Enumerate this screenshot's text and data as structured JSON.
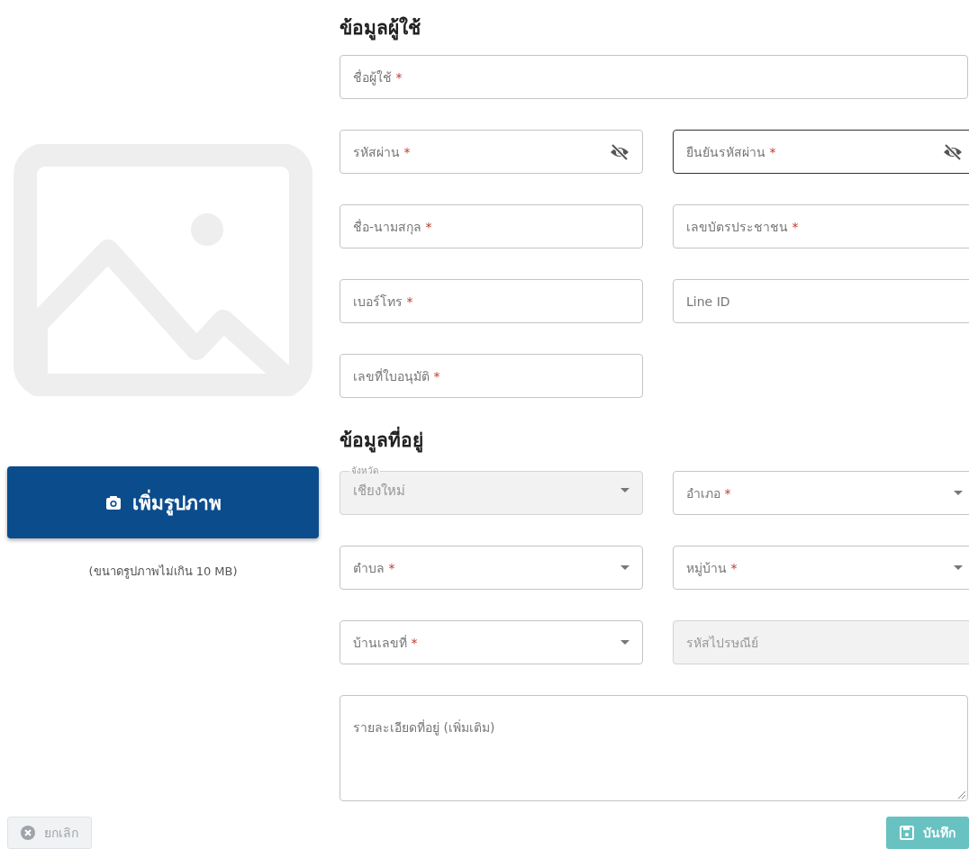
{
  "photo": {
    "kind": "picture",
    "add_button": "เพิ่มรูปภาพ",
    "note": "(ขนาดรูปภาพไม่เกิน 10 MB)"
  },
  "sections": [
    {
      "title": "ข้อมูลผู้ใช้",
      "rows": [
        [
          {
            "kind": "text",
            "placeholder": "ชื่อผู้ใช้",
            "required_mark": "*",
            "full_width": true
          }
        ],
        [
          {
            "kind": "password",
            "placeholder": "รหัสผ่าน",
            "required_mark": "*"
          },
          {
            "kind": "password",
            "placeholder": "ยืนยันรหัสผ่าน",
            "required_mark": "*",
            "focused": true
          }
        ],
        [
          {
            "kind": "text",
            "placeholder": "ชื่อ-นามสกุล",
            "required_mark": "*"
          },
          {
            "kind": "text",
            "placeholder": "เลขบัตรประชาชน",
            "required_mark": "*"
          }
        ],
        [
          {
            "kind": "text",
            "placeholder": "เบอร์โทร",
            "required_mark": "*"
          },
          {
            "kind": "text",
            "placeholder": "Line ID"
          }
        ],
        [
          {
            "kind": "text",
            "placeholder": "เลขที่ใบอนุมัติ",
            "required_mark": "*"
          }
        ]
      ]
    },
    {
      "title": "ข้อมูลที่อยู่",
      "rows": [
        [
          {
            "kind": "select",
            "label": "จังหวัด",
            "value": "เชียงใหม่",
            "disabled": true
          },
          {
            "kind": "select",
            "placeholder": "อำเภอ",
            "required_mark": "*"
          }
        ],
        [
          {
            "kind": "select",
            "placeholder": "ตำบล",
            "required_mark": "*"
          },
          {
            "kind": "select",
            "placeholder": "หมู่บ้าน",
            "required_mark": "*"
          }
        ],
        [
          {
            "kind": "select",
            "placeholder": "บ้านเลขที่",
            "required_mark": "*"
          },
          {
            "kind": "text",
            "placeholder": "รหัสไปรษณีย์",
            "disabled": true
          }
        ],
        [
          {
            "kind": "textarea",
            "placeholder": "รายละเอียดที่อยู่ (เพิ่มเติม)",
            "full_width": true
          }
        ]
      ]
    }
  ],
  "footer": {
    "cancel": {
      "label": "ยกเลิก",
      "disabled": true
    },
    "save": {
      "label": "บันทึก",
      "disabled": true
    }
  }
}
